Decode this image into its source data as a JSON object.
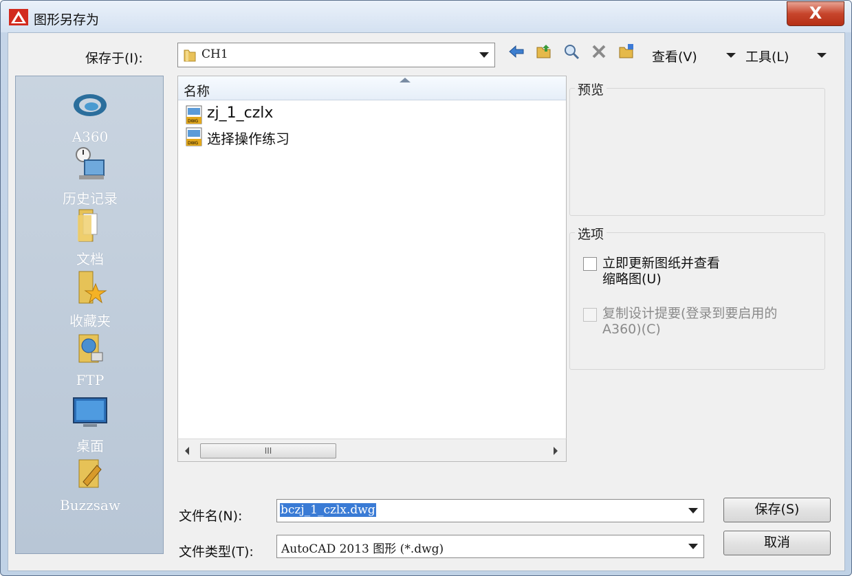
{
  "window": {
    "title": "图形另存为",
    "close_glyph": "X"
  },
  "toolbar": {
    "save_in_label": "保存于(I):",
    "folder_value": "CH1",
    "view_label": "查看(V)",
    "tools_label": "工具(L)",
    "icons": [
      "back-icon",
      "up-folder-icon",
      "search-web-icon",
      "delete-icon",
      "new-folder-icon"
    ]
  },
  "places": [
    {
      "label": "A360",
      "icon": "a360-icon"
    },
    {
      "label": "历史记录",
      "icon": "history-icon"
    },
    {
      "label": "文档",
      "icon": "documents-icon"
    },
    {
      "label": "收藏夹",
      "icon": "favorites-icon"
    },
    {
      "label": "FTP",
      "icon": "ftp-icon"
    },
    {
      "label": "桌面",
      "icon": "desktop-icon"
    },
    {
      "label": "Buzzsaw",
      "icon": "buzzsaw-icon"
    }
  ],
  "file_list": {
    "column_header": "名称",
    "files": [
      {
        "name": "zj_1_czlx",
        "icon": "dwg-file-icon"
      },
      {
        "name": "选择操作练习",
        "icon": "dwg-file-icon"
      }
    ],
    "scroll_thumb": "III"
  },
  "preview": {
    "title": "预览"
  },
  "options": {
    "title": "选项",
    "update_thumbnail": {
      "line1": "立即更新图纸并查看",
      "line2": "缩略图(U)",
      "checked": false
    },
    "copy_design": {
      "line1": "复制设计提要(登录到要启用的",
      "line2": "A360)(C)",
      "checked": false,
      "disabled": true
    }
  },
  "bottom": {
    "filename_label": "文件名(N):",
    "filename_value": "bczj_1_czlx.dwg",
    "filetype_label": "文件类型(T):",
    "filetype_value": "AutoCAD 2013 图形 (*.dwg)",
    "save_button": "保存(S)",
    "cancel_button": "取消"
  },
  "colors": {
    "accent": "#c7452c",
    "selection": "#3a7bd5"
  }
}
